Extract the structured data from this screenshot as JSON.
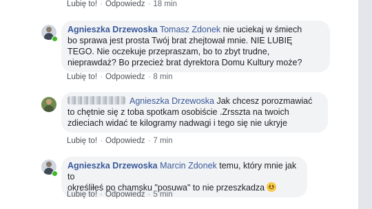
{
  "actions": {
    "like": "Lubię to!",
    "reply": "Odpowiedz",
    "dot": "·"
  },
  "top_row": {
    "time": "18 min"
  },
  "comments": [
    {
      "author": "Agnieszka Drzewoska",
      "mention": "Tomasz Zdonek",
      "text_line1": " nie uciekaj w śmiech",
      "text_line2": "bo sprawa jest prosta Twój brat zhejtował mnie. NIE LUBIĘ",
      "text_line3": "TEGO. Nie oczekuje przepraszam, bo to zbyt trudne,",
      "text_line4": "nieprawdaż? Bo przecież brat dyrektora Domu Kultury może?",
      "time": "8 min"
    },
    {
      "author": "",
      "mention": "Agnieszka Drzewoska",
      "text_line1": " Jak chcesz porozmawiać",
      "text_line2": "to chętnie się z toba spotkam osobiście .Zrsszta na twoich",
      "text_line3": "zdieciach widać te kilogramy nadwagi i tego się nie ukryje",
      "time": "7 min"
    },
    {
      "author": "Agnieszka Drzewoska",
      "mention": "Marcin Zdonek",
      "text_line1": " temu, który mnie jak to",
      "text_line2": "określiłeś po chamsku \"posuwa\" to nie przeszkadza",
      "time": "5 min"
    }
  ]
}
